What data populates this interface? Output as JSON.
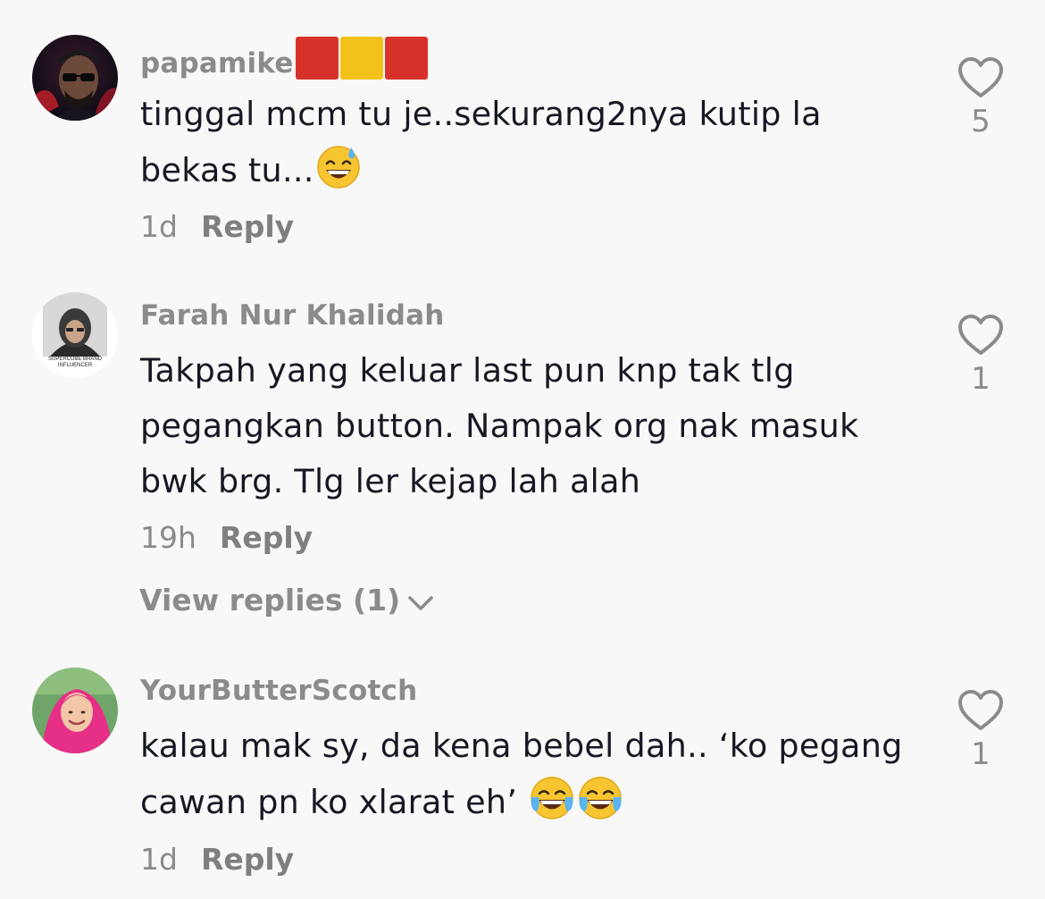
{
  "comments": [
    {
      "username": "papamike",
      "flag_colors": [
        "#d6322a",
        "#f2c21b",
        "#d6322a"
      ],
      "text": "tinggal mcm tu je..sekurang2nya kutip la bekas tu...",
      "emoji_names": [
        "grinning-sweat-emoji"
      ],
      "time": "1d",
      "reply_label": "Reply",
      "like_count": "5"
    },
    {
      "username": "Farah Nur Khalidah",
      "avatar_caption": "SUPERCUBE BRAND INFLUENCER",
      "text": "Takpah yang keluar last pun knp tak tlg pegangkan button. Nampak org nak masuk bwk brg. Tlg ler kejap lah alah",
      "time": "19h",
      "reply_label": "Reply",
      "like_count": "1",
      "view_replies_label": "View replies (1)"
    },
    {
      "username": "YourButterScotch",
      "text": "kalau mak sy, da kena bebel dah.. ‘ko pegang cawan pn ko xlarat eh’",
      "emoji_names": [
        "tears-of-joy-emoji",
        "tears-of-joy-emoji"
      ],
      "time": "1d",
      "reply_label": "Reply",
      "like_count": "1"
    }
  ],
  "colors": {
    "background": "#f8f8f8",
    "text_primary": "#161823",
    "text_secondary": "#8b8b8b"
  }
}
